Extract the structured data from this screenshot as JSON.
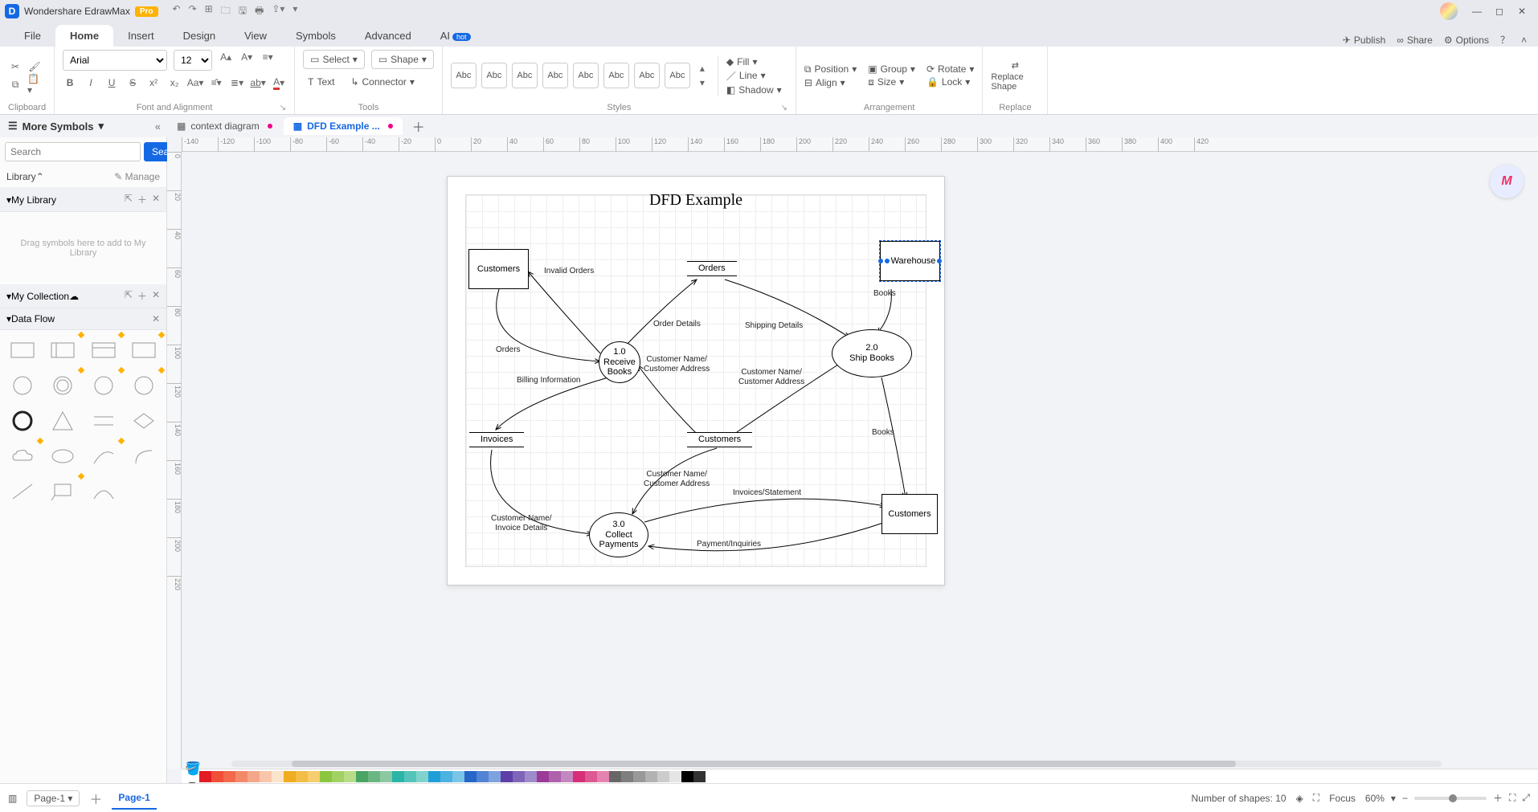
{
  "app": {
    "name": "Wondershare EdrawMax",
    "badge": "Pro"
  },
  "menu": {
    "tabs": [
      "File",
      "Home",
      "Insert",
      "Design",
      "View",
      "Symbols",
      "Advanced"
    ],
    "ai": "AI",
    "hot": "hot",
    "right": {
      "publish": "Publish",
      "share": "Share",
      "options": "Options"
    }
  },
  "ribbon": {
    "clipboard": "Clipboard",
    "font_and_alignment": "Font and Alignment",
    "tools": "Tools",
    "styles": "Styles",
    "arrangement": "Arrangement",
    "replace": "Replace",
    "font": "Arial",
    "size": "12",
    "select": "Select",
    "shape": "Shape",
    "text": "Text",
    "connector": "Connector",
    "abc": "Abc",
    "fill": "Fill",
    "line": "Line",
    "shadow": "Shadow",
    "position": "Position",
    "align": "Align",
    "group": "Group",
    "sizebtn": "Size",
    "rotate": "Rotate",
    "lock": "Lock",
    "replace_shape": "Replace Shape"
  },
  "doctabs": {
    "more_symbols": "More Symbols",
    "t1": "context diagram",
    "t2": "DFD Example ..."
  },
  "sidebar": {
    "search_ph": "Search",
    "search_btn": "Search",
    "library": "Library",
    "manage": "Manage",
    "mylib": "My Library",
    "drop": "Drag symbols here to add to My Library",
    "mycol": "My Collection",
    "dataflow": "Data Flow"
  },
  "ruler_h": [
    "-140",
    "-120",
    "-100",
    "-80",
    "-60",
    "-40",
    "-20",
    "0",
    "20",
    "40",
    "60",
    "80",
    "100",
    "120",
    "140",
    "160",
    "180",
    "200",
    "220",
    "240",
    "260",
    "280",
    "300",
    "320",
    "340",
    "360",
    "380",
    "400",
    "420"
  ],
  "ruler_v": [
    "0",
    "20",
    "40",
    "60",
    "80",
    "100",
    "120",
    "140",
    "160",
    "180",
    "200",
    "220"
  ],
  "diagram": {
    "title": "DFD Example",
    "nodes": {
      "customers1": "Customers",
      "orders_store": "Orders",
      "warehouse": "Warehouse",
      "p1": "1.0\nReceive Books",
      "p2": "2.0\nShip Books",
      "invoices": "Invoices",
      "customers_store": "Customers",
      "p3": "3.0\nCollect Payments",
      "customers2": "Customers"
    },
    "flows": {
      "invalid": "Invalid Orders",
      "orders": "Orders",
      "order_details": "Order Details",
      "shipping": "Shipping Details",
      "cna1": "Customer Name/\nCustomer Address",
      "cna2": "Customer Name/\nCustomer Address",
      "books1": "Books",
      "books2": "Books",
      "billing": "Billing Information",
      "cna3": "Customer Name/\nCustomer Address",
      "invstmt": "Invoices/Statement",
      "cninv": "Customer Name/\nInvoice Details",
      "payinq": "Payment/Inquiries"
    }
  },
  "colors": [
    "#e31b23",
    "#f04e37",
    "#f26a4b",
    "#f4896a",
    "#f6a78a",
    "#f9c6ab",
    "#fbe4cc",
    "#efad1f",
    "#f3bd46",
    "#f6ce6d",
    "#8cc540",
    "#a2d163",
    "#b8dd86",
    "#4aa564",
    "#6bb783",
    "#8cc9a2",
    "#2bb5a8",
    "#55c4ba",
    "#7fd3cc",
    "#1f9fd7",
    "#4cb2df",
    "#79c5e7",
    "#2766c8",
    "#5284d3",
    "#7da2de",
    "#5e3fa6",
    "#7e65b8",
    "#9e8bca",
    "#9b3a97",
    "#af61ac",
    "#c388c1",
    "#d62e79",
    "#de5894",
    "#e682af",
    "#676767",
    "#7f7f7f",
    "#999999",
    "#b2b2b2",
    "#cccccc",
    "#e5e5e5",
    "#000000",
    "#333333",
    "#ffffff"
  ],
  "status": {
    "page_sel": "Page-1",
    "page_tab": "Page-1",
    "shapes": "Number of shapes: 10",
    "focus": "Focus",
    "zoom": "60%"
  }
}
